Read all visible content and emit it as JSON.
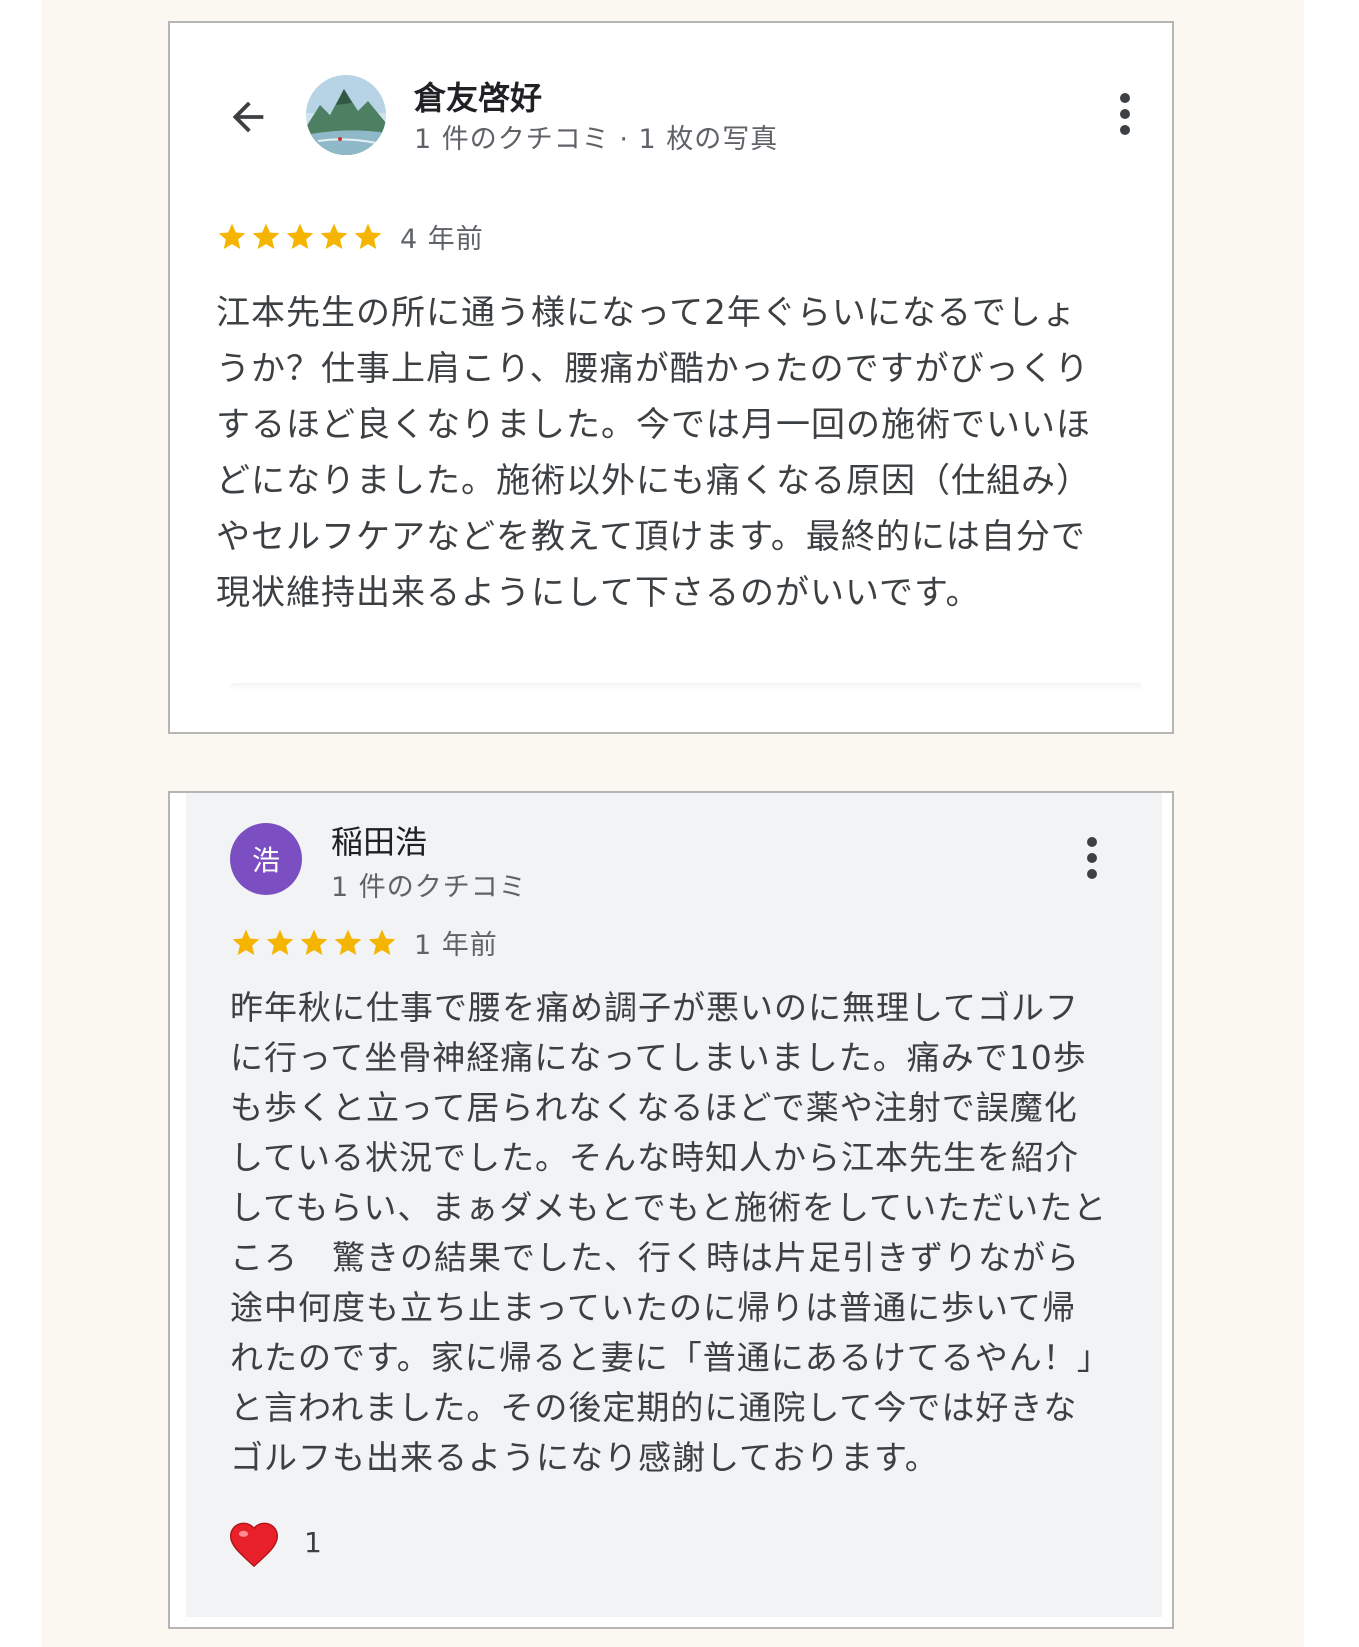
{
  "reviews": [
    {
      "reviewer_name": "倉友啓好",
      "reviewer_meta": "1 件のクチコミ · 1 枚の写真",
      "avatar_type": "photo",
      "rating": 5,
      "age": "4 年前",
      "text": "江本先生の所に通う様になって2年ぐらいになるでしょうか？仕事上肩こり、腰痛が酷かったのですがびっくりするほど良くなりました。今では月一回の施術でいいほどになりました。施術以外にも痛くなる原因（仕組み）やセルフケアなどを教えて頂けます。最終的には自分で現状維持出来るようにして下さるのがいいです。"
    },
    {
      "reviewer_name": "稲田浩",
      "reviewer_initial": "浩",
      "reviewer_meta": "1 件のクチコミ",
      "avatar_color": "#7b4fc2",
      "rating": 5,
      "age": "1 年前",
      "text": "昨年秋に仕事で腰を痛め調子が悪いのに無理してゴルフに行って坐骨神経痛になってしまいました。痛みで10歩も歩くと立って居られなくなるほどで薬や注射で誤魔化している状況でした。そんな時知人から江本先生を紹介してもらい、まぁダメもとでもと施術をしていただいたところ　驚きの結果でした、行く時は片足引きずりながら途中何度も立ち止まっていたのに帰りは普通に歩いて帰れたのです。家に帰ると妻に「普通にあるけてるやん！」と言われました。その後定期的に通院して今では好きなゴルフも出来るようになり感謝しております。",
      "reaction_count": "1"
    }
  ],
  "icons": {
    "back": "back-arrow-icon",
    "more": "more-vert-icon",
    "star": "star-icon",
    "heart": "heart-icon"
  },
  "colors": {
    "star": "#f4b400",
    "initial_avatar": "#7b4fc2",
    "card_border": "#b5b5b5",
    "page_bg": "#fbf8f2"
  }
}
